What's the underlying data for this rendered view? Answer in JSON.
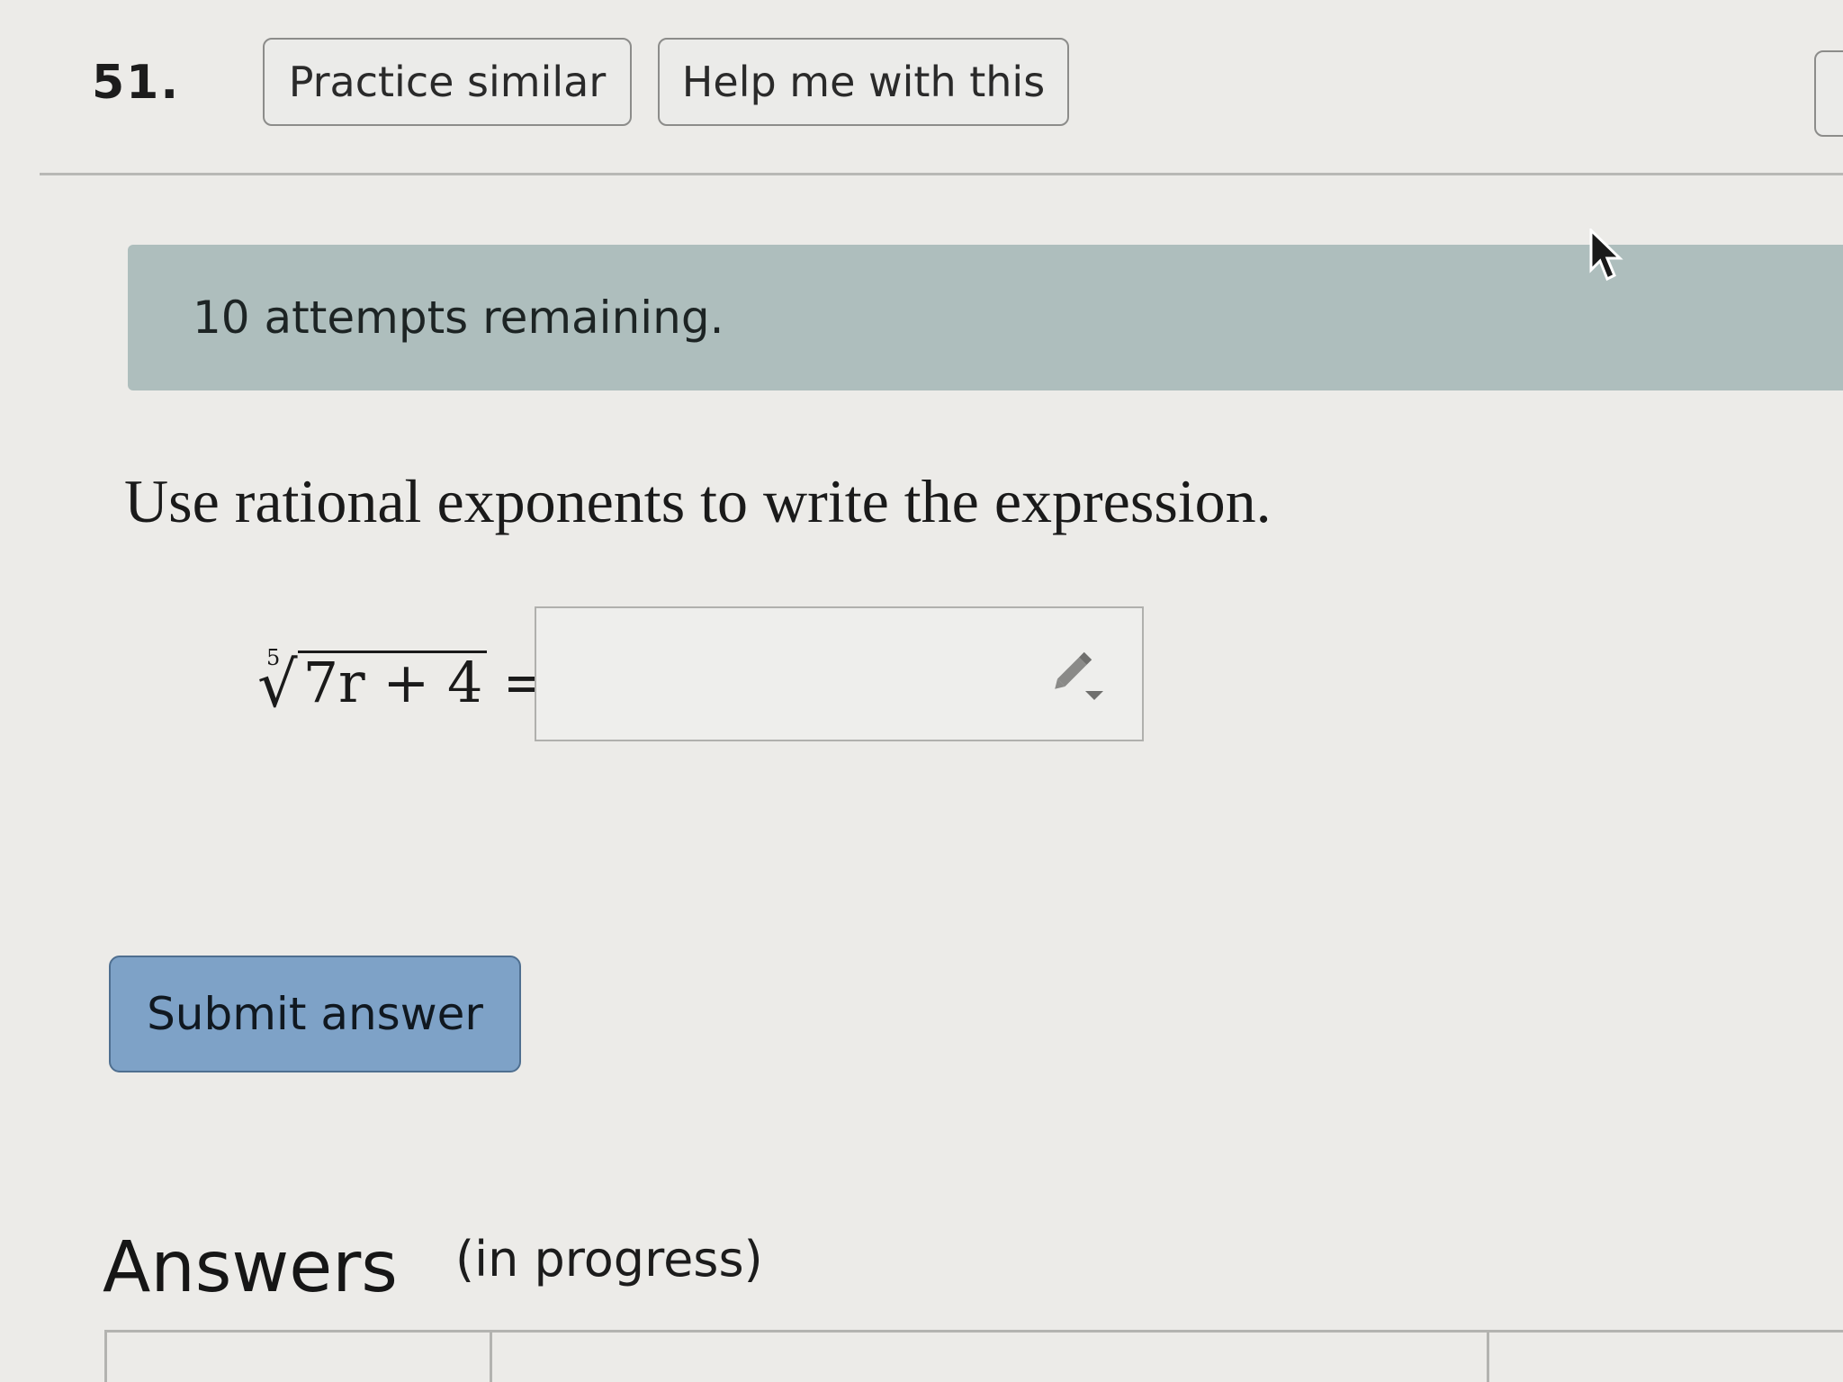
{
  "question": {
    "number": "51."
  },
  "toolbar": {
    "practice_label": "Practice similar",
    "help_label": "Help me with this"
  },
  "banner": {
    "attempts_text": "10 attempts remaining."
  },
  "problem": {
    "prompt": "Use rational exponents to write the expression.",
    "root_index": "5",
    "radicand": "7r + 4",
    "equals": "="
  },
  "answer_input": {
    "value": ""
  },
  "submit": {
    "label": "Submit answer"
  },
  "answers": {
    "heading": "Answers",
    "status": "(in progress)"
  },
  "icons": {
    "cursor": "arrow-cursor-icon",
    "pencil": "pencil-dropdown-icon"
  },
  "colors": {
    "background": "#ecebe8",
    "banner": "#aebebd",
    "submit_button": "#7ea2c7"
  }
}
